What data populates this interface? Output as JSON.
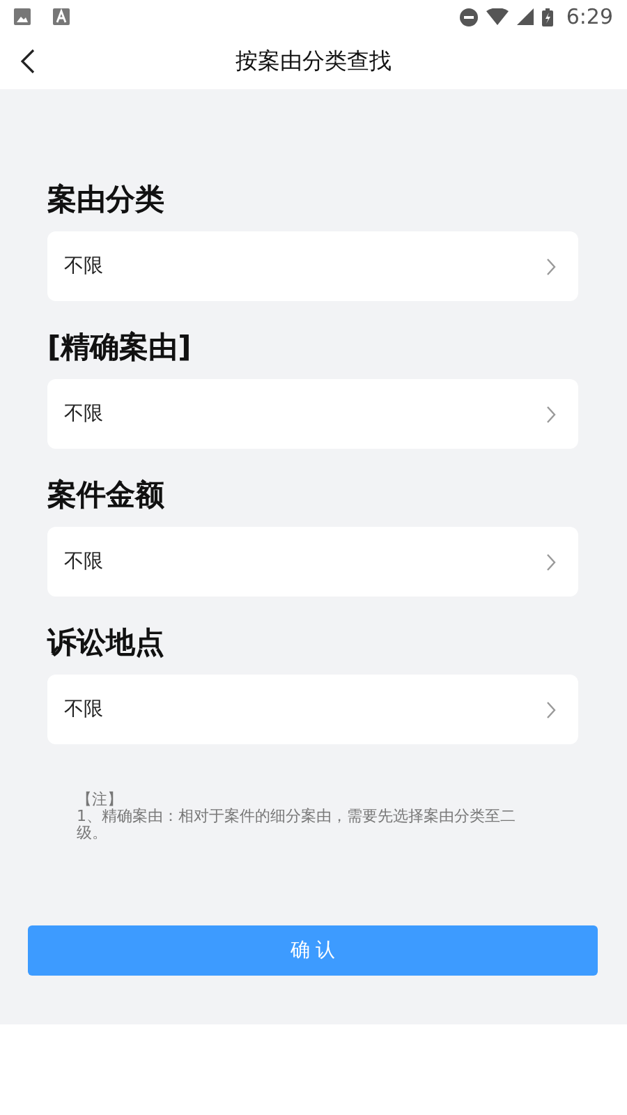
{
  "status_bar": {
    "time": "6:29"
  },
  "header": {
    "title": "按案由分类查找"
  },
  "filters": [
    {
      "label": "案由分类",
      "value": "不限"
    },
    {
      "label": "[精确案由]",
      "value": "不限"
    },
    {
      "label": "案件金额",
      "value": "不限"
    },
    {
      "label": "诉讼地点",
      "value": "不限"
    }
  ],
  "note": {
    "title": "【注】",
    "text": "1、精确案由：相对于案件的细分案由，需要先选择案由分类至二级。"
  },
  "confirm_button": {
    "label": "确 认"
  }
}
